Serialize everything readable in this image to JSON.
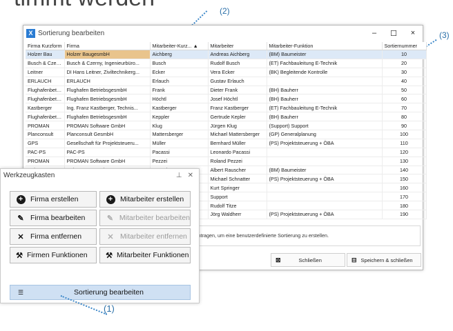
{
  "heading": "timmt werden",
  "callouts": {
    "c1": "(1)",
    "c2": "(2)",
    "c3": "(3)"
  },
  "window": {
    "title": "Sortierung bearbeiten",
    "min_label": "–",
    "max_label": "☐",
    "close_label": "×"
  },
  "table": {
    "columns": [
      "Firma Kurzform",
      "Firma",
      "Mitarbeiter-Kurz... ▲",
      "Mitarbeiter",
      "Mitarbeiter-Funktion",
      "Sortiernummer"
    ],
    "rows": [
      [
        "Holzer Bau",
        "Holzer BaugesmbH",
        "Aichberg",
        "Andreas Aichberg",
        "(BM) Baumeister",
        "10"
      ],
      [
        "Busch & Czerny",
        "Busch & Czerny, Ingenieurbüro...",
        "Busch",
        "Rudolf Busch",
        "(ET) Fachbauleitung E-Technik",
        "20"
      ],
      [
        "Leitner",
        "DI Hans Leitner, Ziviltechnikerg...",
        "Ecker",
        "Vera Ecker",
        "(BK) Begleitende Kontrolle",
        "30"
      ],
      [
        "ERLAUCH",
        "ERLAUCH",
        "Erlauch",
        "Gustav Erlauch",
        "",
        "40"
      ],
      [
        "Flughafenbetrieb",
        "Flughafen BetriebsgesmbH",
        "Frank",
        "Dieter Frank",
        "(BH) Bauherr",
        "50"
      ],
      [
        "Flughafenbetrieb",
        "Flughafen BetriebsgesmbH",
        "Höchtl",
        "Josef Höchtl",
        "(BH) Bauherr",
        "60"
      ],
      [
        "Kastberger",
        "Ing. Franz Kastberger, Technis...",
        "Kastberger",
        "Franz Kastberger",
        "(ET) Fachbauleitung E-Technik",
        "70"
      ],
      [
        "Flughafenbetrieb",
        "Flughafen BetriebsgesmbH",
        "Keppler",
        "Gertrude Kepler",
        "(BH) Bauherr",
        "80"
      ],
      [
        "PROMAN",
        "PROMAN Software GmbH",
        "Klug",
        "Jürgen Klug",
        "(Support) Support",
        "90"
      ],
      [
        "Planconsult",
        "Planconsult GesmbH",
        "Mattersberger",
        "Michael Mattersberger",
        "(GP) Generalplanung",
        "100"
      ],
      [
        "GPS",
        "Gesellschaft für Projektsteueru...",
        "Müller",
        "Bernhard Müller",
        "(PS) Projektsteuerung + ÖBA",
        "110"
      ],
      [
        "PAC-PS",
        "PAC-PS",
        "Pacassi",
        "Leonardo Pacassi",
        "",
        "120"
      ],
      [
        "PROMAN",
        "PROMAN Software GmbH",
        "Pezzei",
        "Roland Pezzei",
        "",
        "130"
      ],
      [
        "Holzer Bau",
        "Holzer BaugesmbH",
        "Rauscher",
        "Albert Rauscher",
        "(BM) Baumeister",
        "140"
      ],
      [
        "",
        "",
        "",
        "Michael Schnatter",
        "(PS) Projektsteuerung + ÖBA",
        "150"
      ],
      [
        "",
        "",
        "",
        "Kurt Springer",
        "",
        "160"
      ],
      [
        "",
        "",
        "",
        "Support",
        "",
        "170"
      ],
      [
        "",
        "",
        "",
        "Rudolf Titze",
        "",
        "180"
      ],
      [
        "",
        "",
        "",
        "Jörg Waldherr",
        "(PS) Projektsteuerung + ÖBA",
        "190"
      ]
    ]
  },
  "info_text": "intragen, um eine benutzerdefinierte Sortierung zu erstellen.",
  "footer": {
    "close_label": "Schließen",
    "save_close_label": "Speichern & schließen"
  },
  "toolbox": {
    "title": "Werkzeugkasten",
    "pin": "⊥",
    "close": "✕",
    "buttons": {
      "firma_erstellen": "Firma erstellen",
      "mitarbeiter_erstellen": "Mitarbeiter erstellen",
      "firma_bearbeiten": "Firma bearbeiten",
      "mitarbeiter_bearbeiten": "Mitarbeiter bearbeiten",
      "firma_entfernen": "Firma entfernen",
      "mitarbeiter_entfernen": "Mitarbeiter entfernen",
      "firmen_funktionen": "Firmen Funktionen",
      "mitarbeiter_funktionen": "Mitarbeiter Funktionen",
      "sortierung": "Sortierung bearbeiten"
    }
  }
}
